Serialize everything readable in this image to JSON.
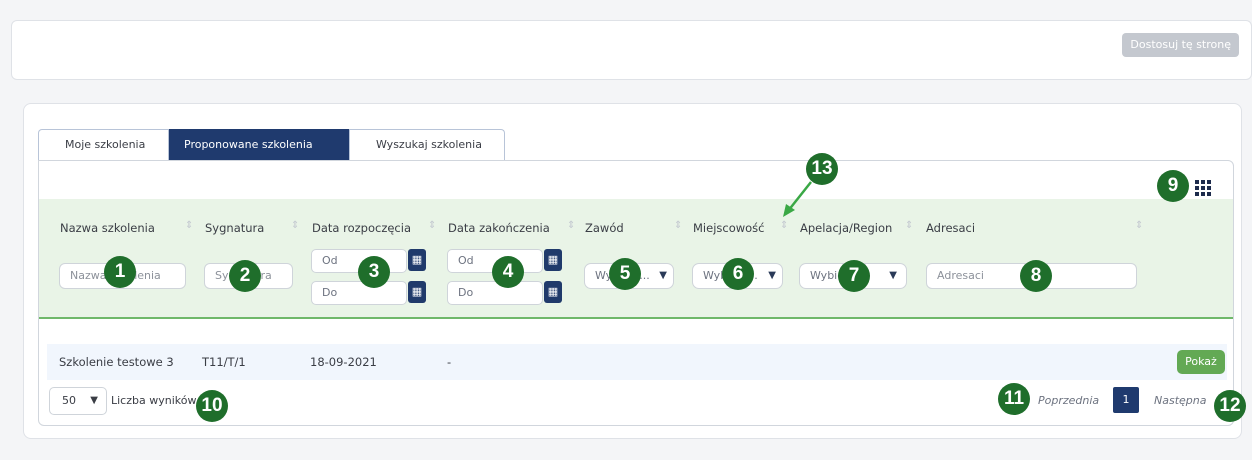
{
  "top_bar": {
    "customize_button": "Dostosuj tę stronę"
  },
  "tabs": [
    {
      "label": "Moje szkolenia"
    },
    {
      "label": "Proponowane szkolenia"
    },
    {
      "label": "Wyszukaj szkolenia"
    }
  ],
  "table": {
    "headers": [
      "Nazwa szkolenia",
      "Sygnatura",
      "Data rozpoczęcia",
      "Data zakończenia",
      "Zawód",
      "Miejscowość",
      "Apelacja/Region",
      "Adresaci"
    ],
    "filters": {
      "name_placeholder": "Nazwa szkolenia",
      "signature_placeholder": "Sygnatura",
      "start_from": "Od",
      "start_to": "Do",
      "end_from": "Od",
      "end_to": "Do",
      "profession_select": "Wybierz...",
      "city_select": "Wybierz...",
      "region_select": "Wybierz",
      "addressees_placeholder": "Adresaci"
    },
    "rows": [
      {
        "name": "Szkolenie testowe 3",
        "signature": "T11/T/1",
        "start_date": "18-09-2021",
        "end_date": "-",
        "action": "Pokaż"
      }
    ]
  },
  "pagination": {
    "page_size": "50",
    "page_size_label": "Liczba wyników",
    "prev": "Poprzednia",
    "current_page": "1",
    "next": "Następna"
  },
  "markers": [
    "1",
    "2",
    "3",
    "4",
    "5",
    "6",
    "7",
    "8",
    "9",
    "10",
    "11",
    "12",
    "13"
  ],
  "colors": {
    "accent_navy": "#1f3a6e",
    "filter_band": "#e9f4e7",
    "marker_green": "#1f6e2b",
    "show_button": "#63a954"
  },
  "icons": [
    "calendar-icon",
    "grid-menu-icon",
    "chevron-down-icon",
    "sort-icon"
  ]
}
